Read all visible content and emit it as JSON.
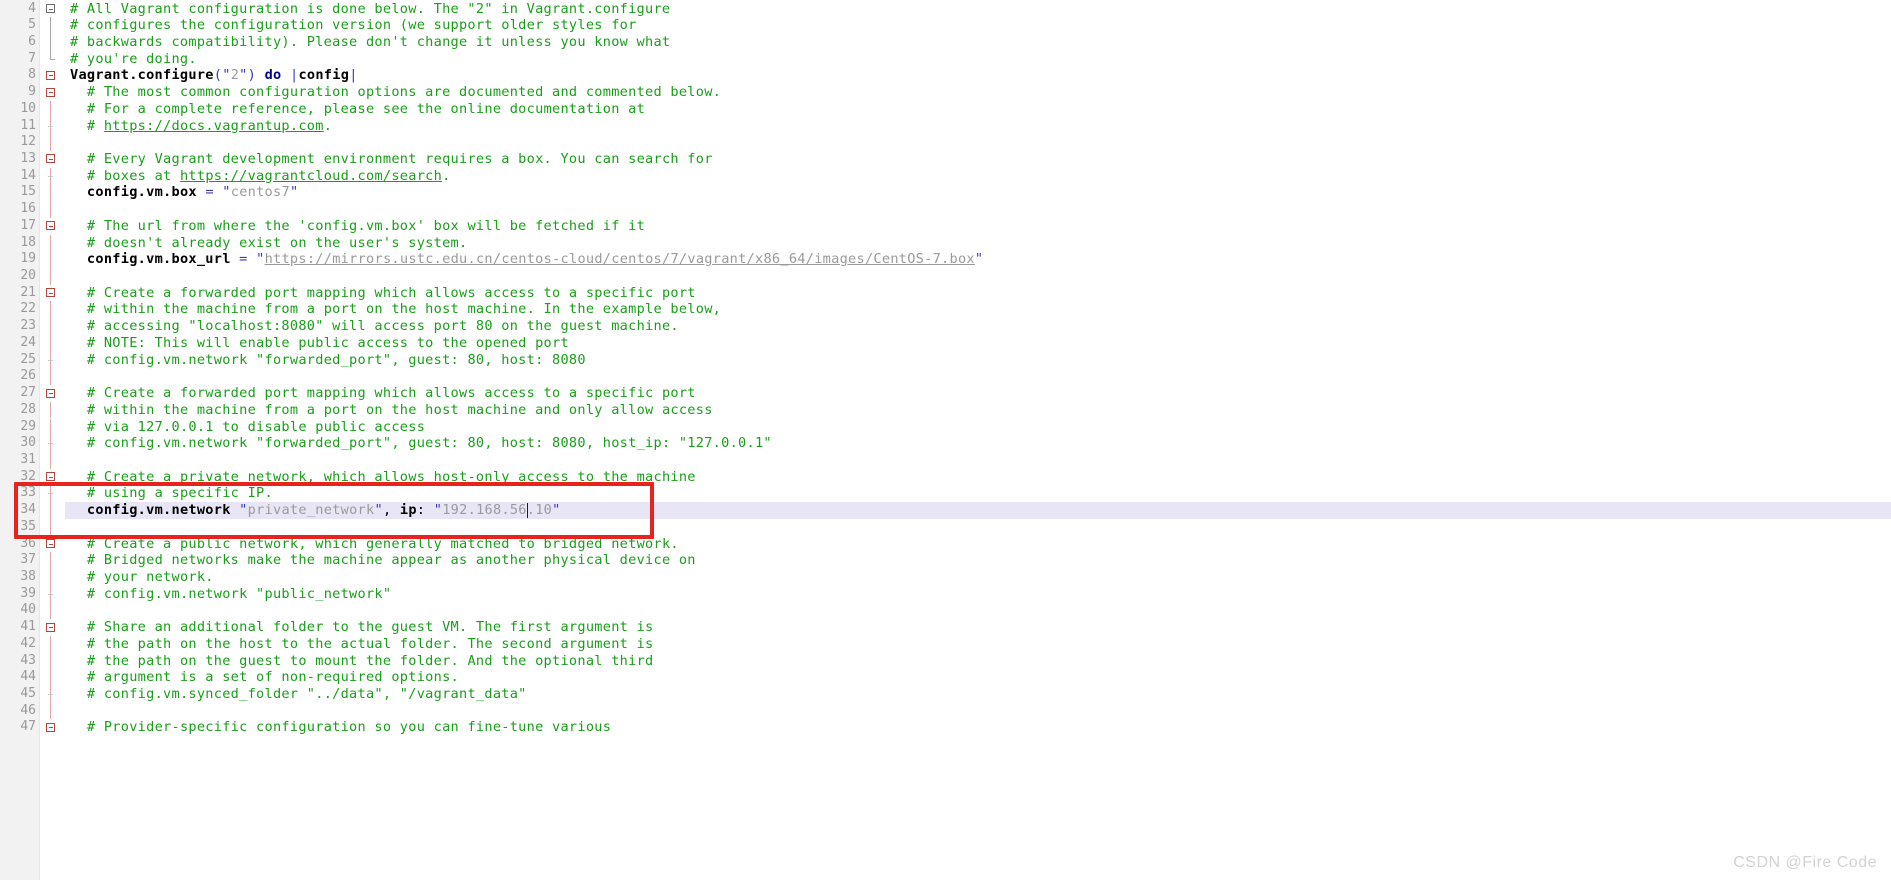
{
  "editor": {
    "app": "code-editor",
    "file_type": "ruby",
    "font_size_px": 13.6,
    "colors": {
      "background": "#ffffff",
      "gutter_background": "#f2f2f2",
      "line_number": "#999999",
      "comment": "#199f19",
      "string": "#9a9a9a",
      "keyword": "#00008b",
      "punctuation": "#3b3bbb",
      "text": "#000000",
      "current_line_highlight": "#e8e6f6",
      "annotation_border": "#e8221d",
      "watermark": "#d2d2d2"
    },
    "current_line_number": 34,
    "caret_after_text": "192.168.56"
  },
  "annotation": {
    "name": "red-highlight-rectangle",
    "covers_lines": [
      33,
      34,
      35
    ],
    "color": "#e8221d"
  },
  "watermark": {
    "text": "CSDN @Fire Code"
  },
  "lines": [
    {
      "n": "4",
      "fold": "start-grey",
      "text": "# All Vagrant configuration is done below. The \"2\" in Vagrant.configure"
    },
    {
      "n": "5",
      "fold": "mid-grey",
      "text": "# configures the configuration version (we support older styles for"
    },
    {
      "n": "6",
      "fold": "mid-grey",
      "text": "# backwards compatibility). Please don't change it unless you know what"
    },
    {
      "n": "7",
      "fold": "end-grey",
      "text": "# you're doing."
    },
    {
      "n": "8",
      "fold": "start-red",
      "text": "Vagrant.configure(\"2\") do |config|"
    },
    {
      "n": "9",
      "fold": "start-red",
      "text": "  # The most common configuration options are documented and commented below."
    },
    {
      "n": "10",
      "fold": "rail",
      "text": "  # For a complete reference, please see the online documentation at"
    },
    {
      "n": "11",
      "fold": "dash",
      "text": "  # https://docs.vagrantup.com."
    },
    {
      "n": "12",
      "fold": "rail",
      "text": ""
    },
    {
      "n": "13",
      "fold": "start-red",
      "text": "  # Every Vagrant development environment requires a box. You can search for"
    },
    {
      "n": "14",
      "fold": "dash",
      "text": "  # boxes at https://vagrantcloud.com/search."
    },
    {
      "n": "15",
      "fold": "rail",
      "text": "  config.vm.box = \"centos7\""
    },
    {
      "n": "16",
      "fold": "rail",
      "text": ""
    },
    {
      "n": "17",
      "fold": "start-red",
      "text": "  # The url from where the 'config.vm.box' box will be fetched if it"
    },
    {
      "n": "18",
      "fold": "rail",
      "text": "  # doesn't already exist on the user's system."
    },
    {
      "n": "19",
      "fold": "rail",
      "text": "  config.vm.box_url = \"https://mirrors.ustc.edu.cn/centos-cloud/centos/7/vagrant/x86_64/images/CentOS-7.box\""
    },
    {
      "n": "20",
      "fold": "rail",
      "text": ""
    },
    {
      "n": "21",
      "fold": "start-red",
      "text": "  # Create a forwarded port mapping which allows access to a specific port"
    },
    {
      "n": "22",
      "fold": "rail",
      "text": "  # within the machine from a port on the host machine. In the example below,"
    },
    {
      "n": "23",
      "fold": "rail",
      "text": "  # accessing \"localhost:8080\" will access port 80 on the guest machine."
    },
    {
      "n": "24",
      "fold": "rail",
      "text": "  # NOTE: This will enable public access to the opened port"
    },
    {
      "n": "25",
      "fold": "dash",
      "text": "  # config.vm.network \"forwarded_port\", guest: 80, host: 8080"
    },
    {
      "n": "26",
      "fold": "rail",
      "text": ""
    },
    {
      "n": "27",
      "fold": "start-red",
      "text": "  # Create a forwarded port mapping which allows access to a specific port"
    },
    {
      "n": "28",
      "fold": "rail",
      "text": "  # within the machine from a port on the host machine and only allow access"
    },
    {
      "n": "29",
      "fold": "rail",
      "text": "  # via 127.0.0.1 to disable public access"
    },
    {
      "n": "30",
      "fold": "dash",
      "text": "  # config.vm.network \"forwarded_port\", guest: 80, host: 8080, host_ip: \"127.0.0.1\""
    },
    {
      "n": "31",
      "fold": "rail",
      "text": ""
    },
    {
      "n": "32",
      "fold": "start-red",
      "text": "  # Create a private network, which allows host-only access to the machine"
    },
    {
      "n": "33",
      "fold": "dash",
      "text": "  # using a specific IP."
    },
    {
      "n": "34",
      "fold": "rail",
      "text": "  config.vm.network \"private_network\", ip: \"192.168.56.10\""
    },
    {
      "n": "35",
      "fold": "rail",
      "text": ""
    },
    {
      "n": "36",
      "fold": "start-red",
      "text": "  # Create a public network, which generally matched to bridged network."
    },
    {
      "n": "37",
      "fold": "rail",
      "text": "  # Bridged networks make the machine appear as another physical device on"
    },
    {
      "n": "38",
      "fold": "rail",
      "text": "  # your network."
    },
    {
      "n": "39",
      "fold": "dash",
      "text": "  # config.vm.network \"public_network\""
    },
    {
      "n": "40",
      "fold": "rail",
      "text": ""
    },
    {
      "n": "41",
      "fold": "start-red",
      "text": "  # Share an additional folder to the guest VM. The first argument is"
    },
    {
      "n": "42",
      "fold": "rail",
      "text": "  # the path on the host to the actual folder. The second argument is"
    },
    {
      "n": "43",
      "fold": "rail",
      "text": "  # the path on the guest to mount the folder. And the optional third"
    },
    {
      "n": "44",
      "fold": "rail",
      "text": "  # argument is a set of non-required options."
    },
    {
      "n": "45",
      "fold": "dash",
      "text": "  # config.vm.synced_folder \"../data\", \"/vagrant_data\""
    },
    {
      "n": "46",
      "fold": "rail",
      "text": ""
    },
    {
      "n": "47",
      "fold": "start-red",
      "text": "  # Provider-specific configuration so you can fine-tune various"
    }
  ]
}
